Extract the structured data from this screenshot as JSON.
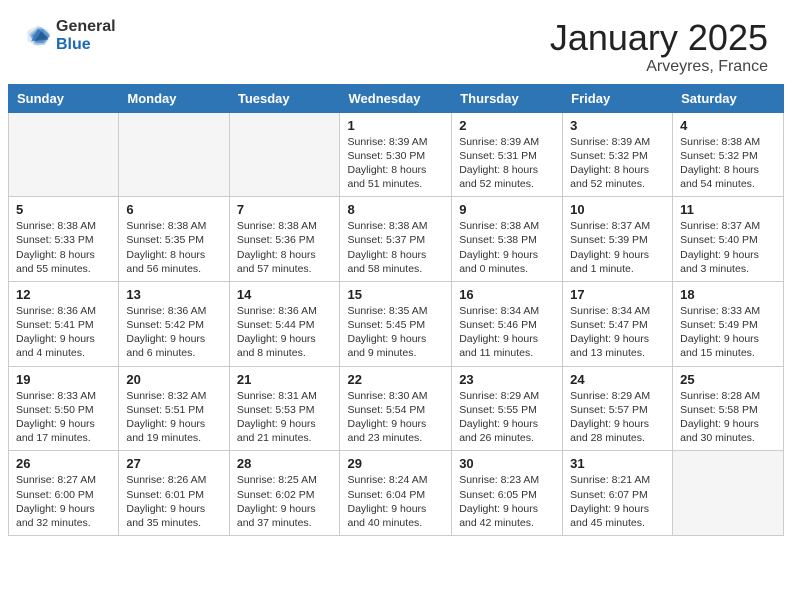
{
  "header": {
    "logo_general": "General",
    "logo_blue": "Blue",
    "month_year": "January 2025",
    "location": "Arveyres, France"
  },
  "days_of_week": [
    "Sunday",
    "Monday",
    "Tuesday",
    "Wednesday",
    "Thursday",
    "Friday",
    "Saturday"
  ],
  "weeks": [
    [
      {
        "num": "",
        "info": ""
      },
      {
        "num": "",
        "info": ""
      },
      {
        "num": "",
        "info": ""
      },
      {
        "num": "1",
        "info": "Sunrise: 8:39 AM\nSunset: 5:30 PM\nDaylight: 8 hours\nand 51 minutes."
      },
      {
        "num": "2",
        "info": "Sunrise: 8:39 AM\nSunset: 5:31 PM\nDaylight: 8 hours\nand 52 minutes."
      },
      {
        "num": "3",
        "info": "Sunrise: 8:39 AM\nSunset: 5:32 PM\nDaylight: 8 hours\nand 52 minutes."
      },
      {
        "num": "4",
        "info": "Sunrise: 8:38 AM\nSunset: 5:32 PM\nDaylight: 8 hours\nand 54 minutes."
      }
    ],
    [
      {
        "num": "5",
        "info": "Sunrise: 8:38 AM\nSunset: 5:33 PM\nDaylight: 8 hours\nand 55 minutes."
      },
      {
        "num": "6",
        "info": "Sunrise: 8:38 AM\nSunset: 5:35 PM\nDaylight: 8 hours\nand 56 minutes."
      },
      {
        "num": "7",
        "info": "Sunrise: 8:38 AM\nSunset: 5:36 PM\nDaylight: 8 hours\nand 57 minutes."
      },
      {
        "num": "8",
        "info": "Sunrise: 8:38 AM\nSunset: 5:37 PM\nDaylight: 8 hours\nand 58 minutes."
      },
      {
        "num": "9",
        "info": "Sunrise: 8:38 AM\nSunset: 5:38 PM\nDaylight: 9 hours\nand 0 minutes."
      },
      {
        "num": "10",
        "info": "Sunrise: 8:37 AM\nSunset: 5:39 PM\nDaylight: 9 hours\nand 1 minute."
      },
      {
        "num": "11",
        "info": "Sunrise: 8:37 AM\nSunset: 5:40 PM\nDaylight: 9 hours\nand 3 minutes."
      }
    ],
    [
      {
        "num": "12",
        "info": "Sunrise: 8:36 AM\nSunset: 5:41 PM\nDaylight: 9 hours\nand 4 minutes."
      },
      {
        "num": "13",
        "info": "Sunrise: 8:36 AM\nSunset: 5:42 PM\nDaylight: 9 hours\nand 6 minutes."
      },
      {
        "num": "14",
        "info": "Sunrise: 8:36 AM\nSunset: 5:44 PM\nDaylight: 9 hours\nand 8 minutes."
      },
      {
        "num": "15",
        "info": "Sunrise: 8:35 AM\nSunset: 5:45 PM\nDaylight: 9 hours\nand 9 minutes."
      },
      {
        "num": "16",
        "info": "Sunrise: 8:34 AM\nSunset: 5:46 PM\nDaylight: 9 hours\nand 11 minutes."
      },
      {
        "num": "17",
        "info": "Sunrise: 8:34 AM\nSunset: 5:47 PM\nDaylight: 9 hours\nand 13 minutes."
      },
      {
        "num": "18",
        "info": "Sunrise: 8:33 AM\nSunset: 5:49 PM\nDaylight: 9 hours\nand 15 minutes."
      }
    ],
    [
      {
        "num": "19",
        "info": "Sunrise: 8:33 AM\nSunset: 5:50 PM\nDaylight: 9 hours\nand 17 minutes."
      },
      {
        "num": "20",
        "info": "Sunrise: 8:32 AM\nSunset: 5:51 PM\nDaylight: 9 hours\nand 19 minutes."
      },
      {
        "num": "21",
        "info": "Sunrise: 8:31 AM\nSunset: 5:53 PM\nDaylight: 9 hours\nand 21 minutes."
      },
      {
        "num": "22",
        "info": "Sunrise: 8:30 AM\nSunset: 5:54 PM\nDaylight: 9 hours\nand 23 minutes."
      },
      {
        "num": "23",
        "info": "Sunrise: 8:29 AM\nSunset: 5:55 PM\nDaylight: 9 hours\nand 26 minutes."
      },
      {
        "num": "24",
        "info": "Sunrise: 8:29 AM\nSunset: 5:57 PM\nDaylight: 9 hours\nand 28 minutes."
      },
      {
        "num": "25",
        "info": "Sunrise: 8:28 AM\nSunset: 5:58 PM\nDaylight: 9 hours\nand 30 minutes."
      }
    ],
    [
      {
        "num": "26",
        "info": "Sunrise: 8:27 AM\nSunset: 6:00 PM\nDaylight: 9 hours\nand 32 minutes."
      },
      {
        "num": "27",
        "info": "Sunrise: 8:26 AM\nSunset: 6:01 PM\nDaylight: 9 hours\nand 35 minutes."
      },
      {
        "num": "28",
        "info": "Sunrise: 8:25 AM\nSunset: 6:02 PM\nDaylight: 9 hours\nand 37 minutes."
      },
      {
        "num": "29",
        "info": "Sunrise: 8:24 AM\nSunset: 6:04 PM\nDaylight: 9 hours\nand 40 minutes."
      },
      {
        "num": "30",
        "info": "Sunrise: 8:23 AM\nSunset: 6:05 PM\nDaylight: 9 hours\nand 42 minutes."
      },
      {
        "num": "31",
        "info": "Sunrise: 8:21 AM\nSunset: 6:07 PM\nDaylight: 9 hours\nand 45 minutes."
      },
      {
        "num": "",
        "info": ""
      }
    ]
  ]
}
